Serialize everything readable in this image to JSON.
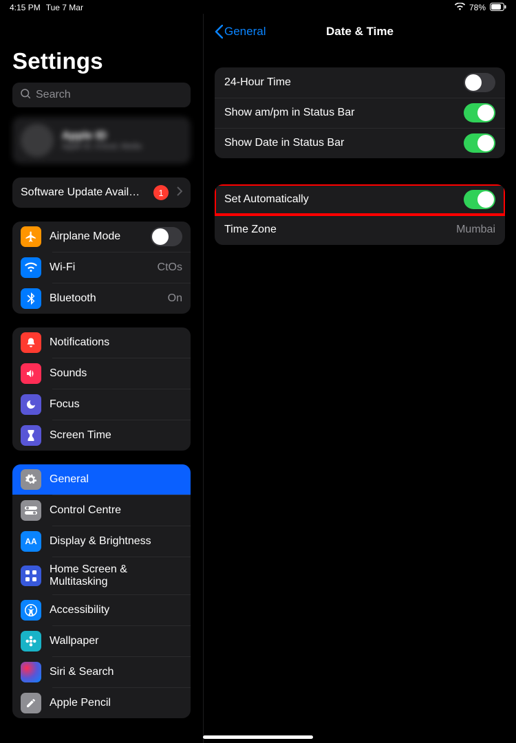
{
  "status": {
    "time": "4:15 PM",
    "date": "Tue 7 Mar",
    "battery": "78%"
  },
  "sidebar": {
    "title": "Settings",
    "search_placeholder": "Search",
    "profile": {
      "name": "Apple ID",
      "sub": "Apple ID, iCloud, Media"
    },
    "update": {
      "label": "Software Update Avail…",
      "badge": "1"
    },
    "net": {
      "airplane": {
        "label": "Airplane Mode",
        "on": false
      },
      "wifi": {
        "label": "Wi-Fi",
        "value": "CtOs"
      },
      "bt": {
        "label": "Bluetooth",
        "value": "On"
      }
    },
    "sys": {
      "notif": "Notifications",
      "sounds": "Sounds",
      "focus": "Focus",
      "st": "Screen Time"
    },
    "more": {
      "general": "General",
      "cc": "Control Centre",
      "disp": "Display & Brightness",
      "home": "Home Screen & Multitasking",
      "acc": "Accessibility",
      "wall": "Wallpaper",
      "siri": "Siri & Search",
      "pencil": "Apple Pencil"
    }
  },
  "detail": {
    "back": "General",
    "title": "Date & Time",
    "g1": {
      "r1": {
        "label": "24-Hour Time",
        "on": false
      },
      "r2": {
        "label": "Show am/pm in Status Bar",
        "on": true
      },
      "r3": {
        "label": "Show Date in Status Bar",
        "on": true
      }
    },
    "g2": {
      "r1": {
        "label": "Set Automatically",
        "on": true
      },
      "r2": {
        "label": "Time Zone",
        "value": "Mumbai"
      }
    }
  }
}
